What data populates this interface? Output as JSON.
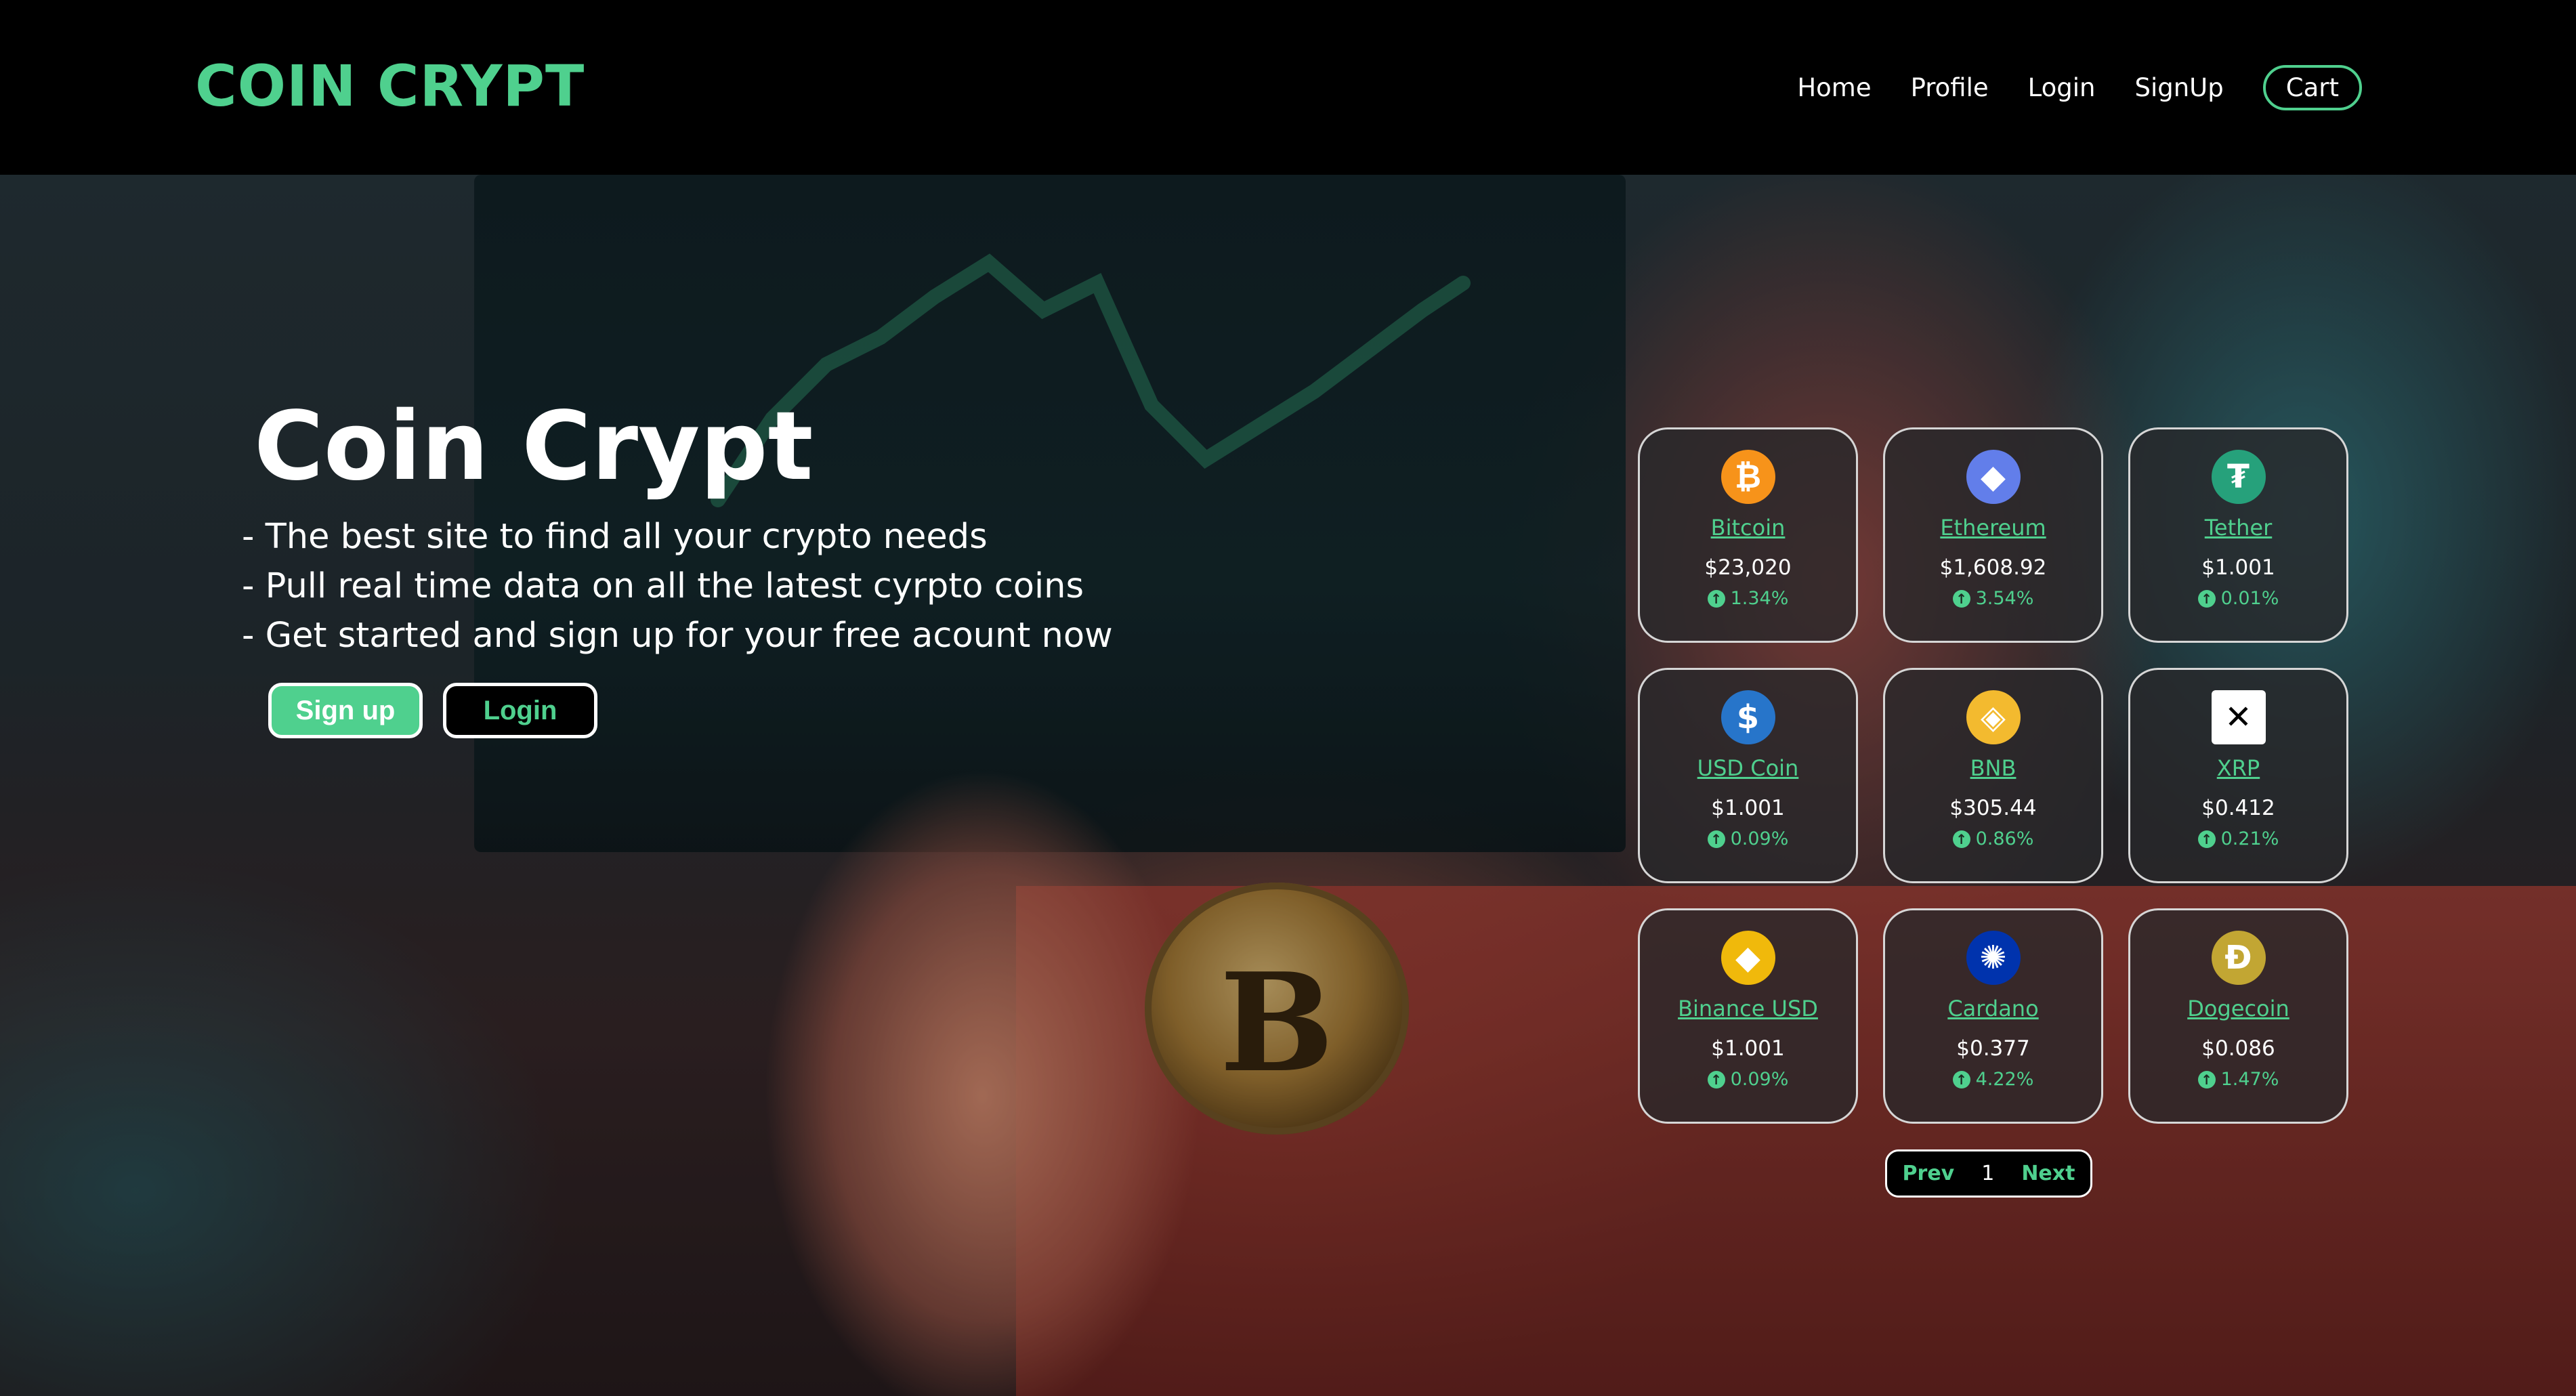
{
  "header": {
    "brand": "COIN CRYPT",
    "nav": [
      "Home",
      "Profile",
      "Login",
      "SignUp"
    ],
    "cart": "Cart"
  },
  "hero": {
    "title": "Coin Crypt",
    "bullets": [
      "- The best site to find all your crypto needs",
      "- Pull real time data on all the latest cyrpto coins",
      "- Get started and sign up for your free acount now"
    ],
    "signup_label": "Sign up",
    "login_label": "Login"
  },
  "coins": [
    {
      "name": "Bitcoin",
      "price": "$23,020",
      "change": "1.34%",
      "icon": "bitcoin-icon",
      "color": "#f7931a",
      "glyph": "₿"
    },
    {
      "name": "Ethereum",
      "price": "$1,608.92",
      "change": "3.54%",
      "icon": "ethereum-icon",
      "color": "#627eea",
      "glyph": "◆"
    },
    {
      "name": "Tether",
      "price": "$1.001",
      "change": "0.01%",
      "icon": "tether-icon",
      "color": "#26a17b",
      "glyph": "₮"
    },
    {
      "name": "USD Coin",
      "price": "$1.001",
      "change": "0.09%",
      "icon": "usd-coin-icon",
      "color": "#2775ca",
      "glyph": "$"
    },
    {
      "name": "BNB",
      "price": "$305.44",
      "change": "0.86%",
      "icon": "bnb-icon",
      "color": "#f3ba2f",
      "glyph": "◈"
    },
    {
      "name": "XRP",
      "price": "$0.412",
      "change": "0.21%",
      "icon": "xrp-icon",
      "color": "#ffffff",
      "glyph": "✕"
    },
    {
      "name": "Binance USD",
      "price": "$1.001",
      "change": "0.09%",
      "icon": "binance-usd-icon",
      "color": "#f0b90b",
      "glyph": "◆"
    },
    {
      "name": "Cardano",
      "price": "$0.377",
      "change": "4.22%",
      "icon": "cardano-icon",
      "color": "#0033ad",
      "glyph": "✺"
    },
    {
      "name": "Dogecoin",
      "price": "$0.086",
      "change": "1.47%",
      "icon": "dogecoin-icon",
      "color": "#c2a633",
      "glyph": "Ð"
    }
  ],
  "pager": {
    "prev": "Prev",
    "page": "1",
    "next": "Next"
  },
  "colors": {
    "accent": "#4fd08e",
    "header_bg": "#000000"
  }
}
